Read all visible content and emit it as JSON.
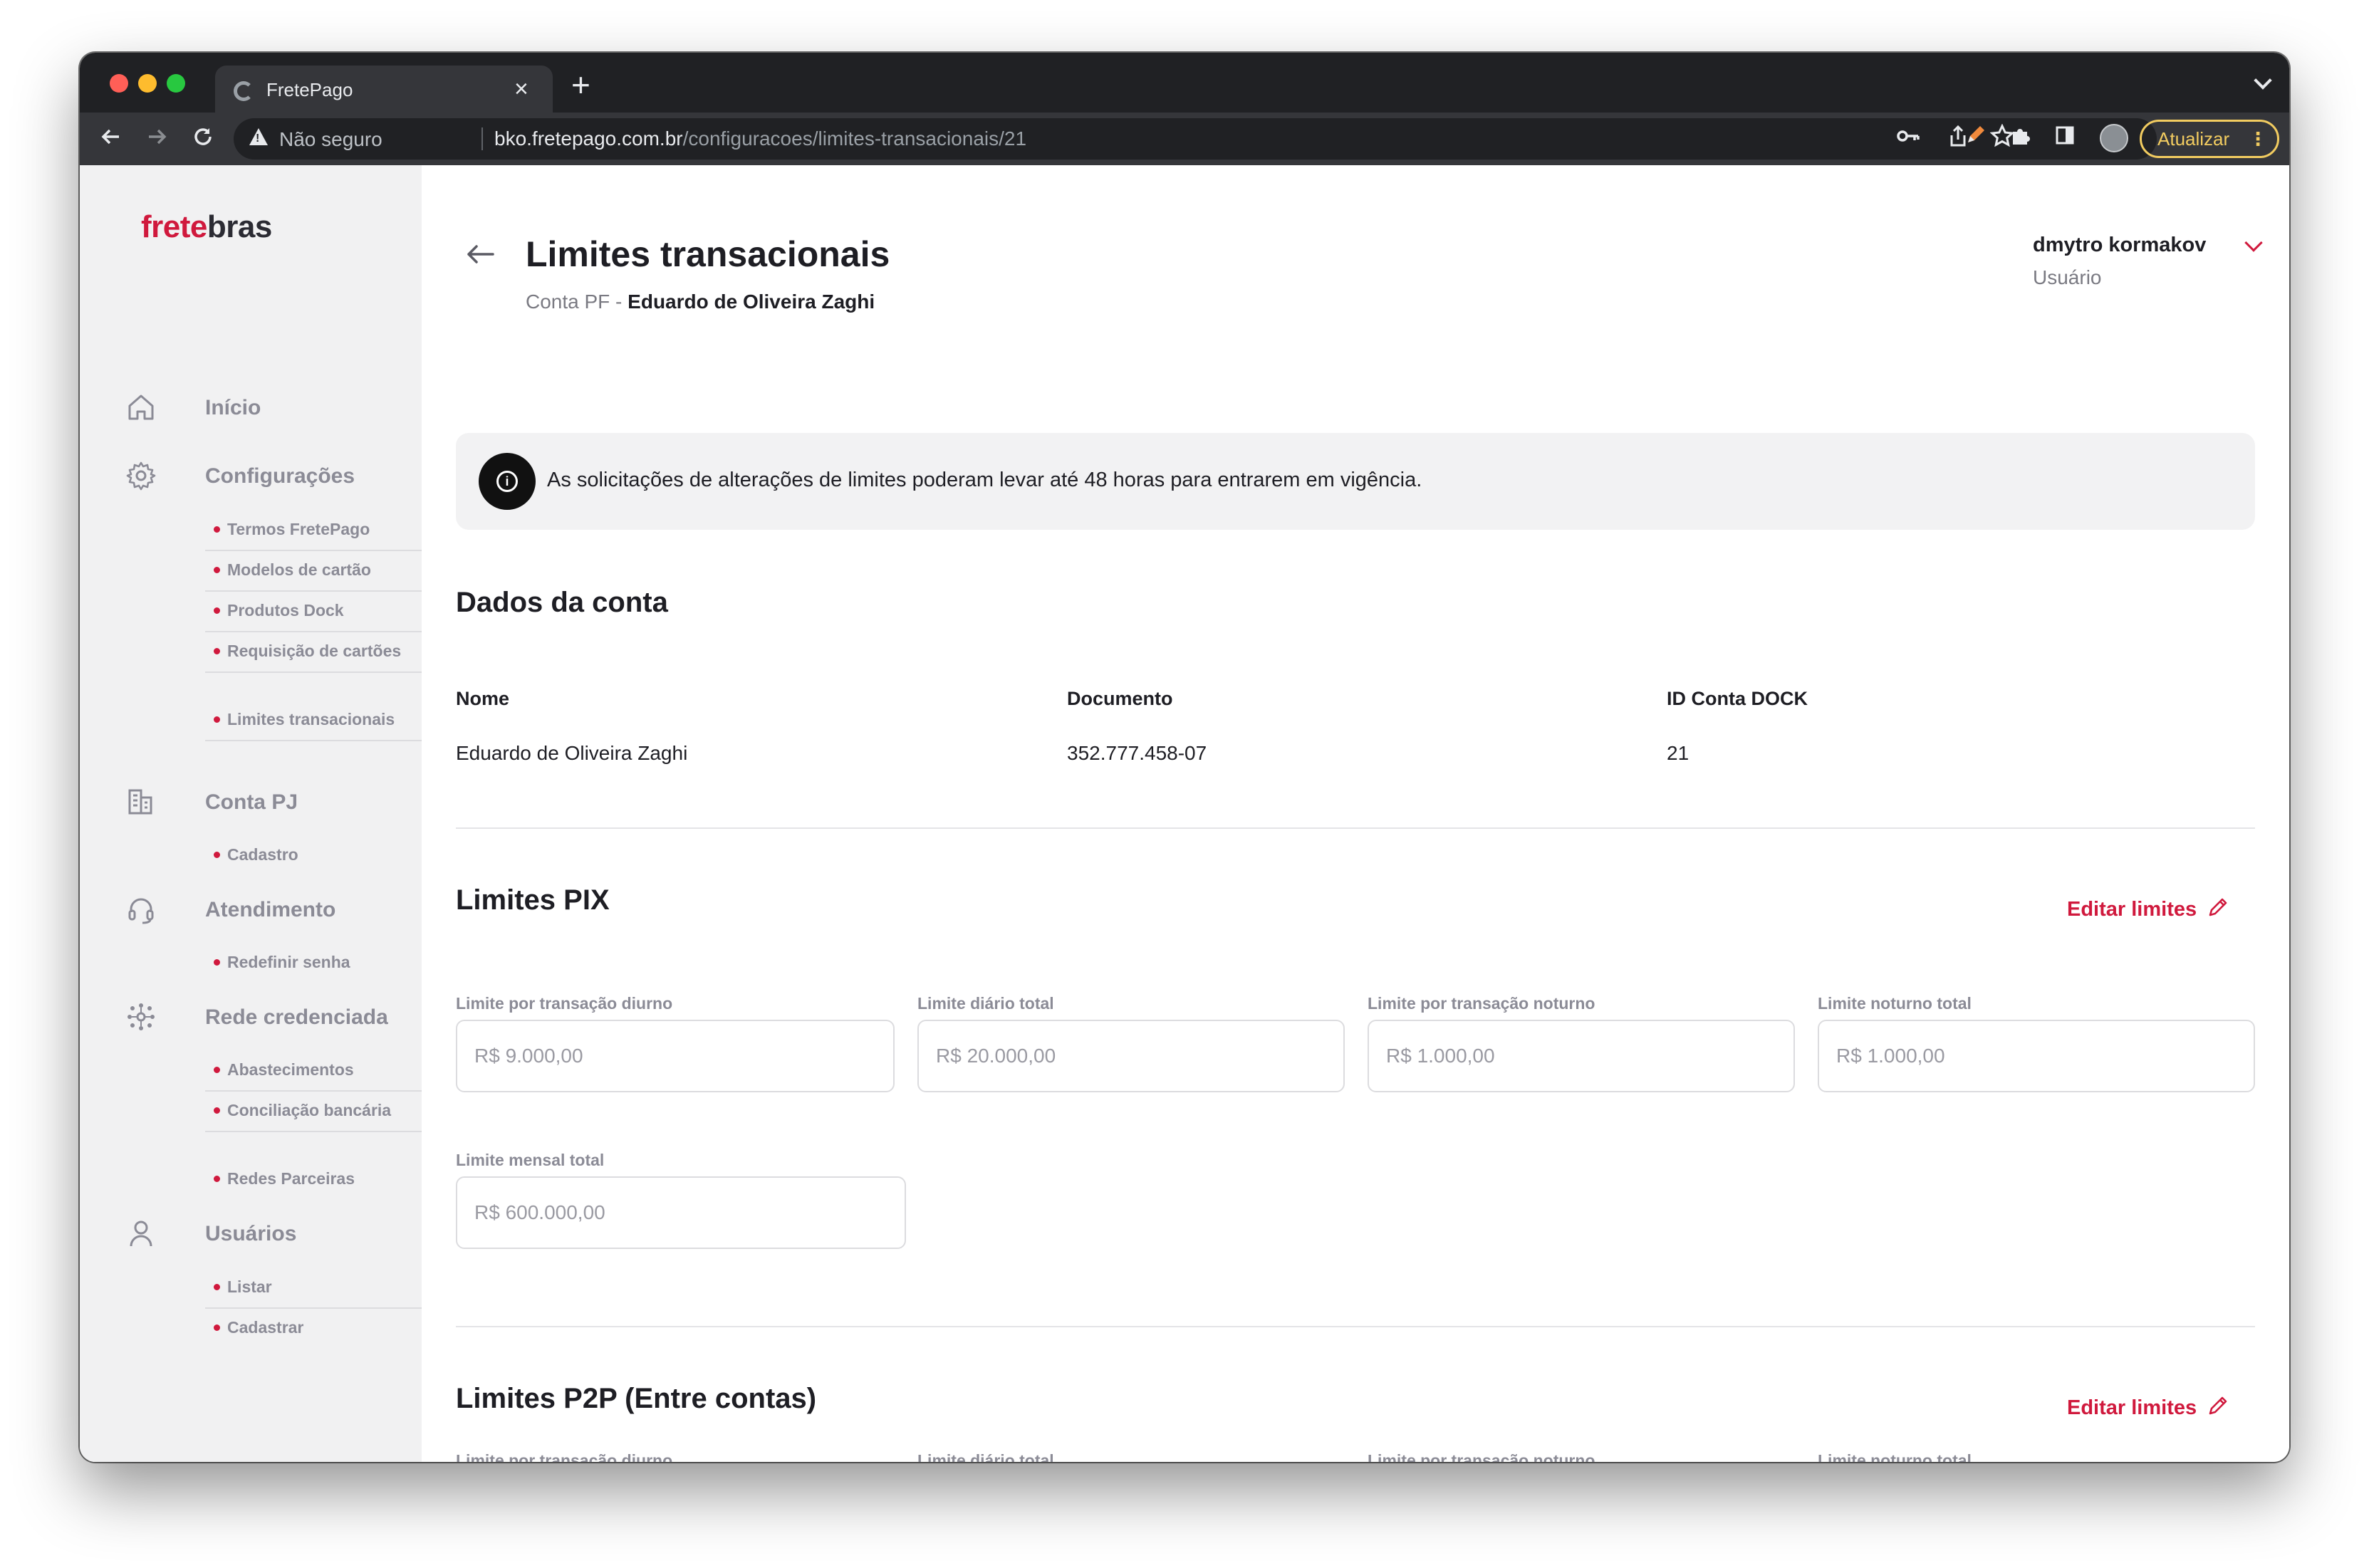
{
  "browser": {
    "tab_title": "FretePago",
    "security_label": "Não seguro",
    "url_host": "bko.fretepago.com.br",
    "url_path": "/configuracoes/limites-transacionais/21",
    "update_label": "Atualizar",
    "colors": {
      "chrome_dark": "#202124",
      "chrome_toolbar": "#35363a",
      "update_accent": "#f2cc60"
    }
  },
  "brand": {
    "logo_part1": "frete",
    "logo_part2": "bras",
    "accent_color": "#d0193d"
  },
  "sidebar": {
    "groups": [
      {
        "label": "Início",
        "icon": "home-icon",
        "items": []
      },
      {
        "label": "Configurações",
        "icon": "gear-icon",
        "items": [
          "Termos FretePago",
          "Modelos de cartão",
          "Produtos Dock",
          "Requisição de cartões",
          "Limites transacionais"
        ]
      },
      {
        "label": "Conta PJ",
        "icon": "building-icon",
        "items": [
          "Cadastro"
        ]
      },
      {
        "label": "Atendimento",
        "icon": "headset-icon",
        "items": [
          "Redefinir senha"
        ]
      },
      {
        "label": "Rede credenciada",
        "icon": "network-icon",
        "items": [
          "Abastecimentos",
          "Conciliação bancária",
          "Redes Parceiras"
        ]
      },
      {
        "label": "Usuários",
        "icon": "user-icon",
        "items": [
          "Listar",
          "Cadastrar"
        ]
      }
    ]
  },
  "header": {
    "title": "Limites transacionais",
    "subtitle_prefix": "Conta PF - ",
    "subtitle_name": "Eduardo de Oliveira Zaghi",
    "user_name": "dmytro kormakov",
    "user_role": "Usuário"
  },
  "alert": {
    "icon": "info-icon",
    "text": "As solicitações de alterações de limites poderam levar até 48 horas para entrarem em vigência."
  },
  "account": {
    "title": "Dados da conta",
    "columns": [
      {
        "label": "Nome",
        "value": "Eduardo de Oliveira Zaghi"
      },
      {
        "label": "Documento",
        "value": "352.777.458-07"
      },
      {
        "label": "ID Conta DOCK",
        "value": "21"
      }
    ]
  },
  "pix": {
    "title": "Limites PIX",
    "edit_label": "Editar limites",
    "fields": [
      {
        "label": "Limite por transação diurno",
        "value": "R$ 9.000,00"
      },
      {
        "label": "Limite diário total",
        "value": "R$ 20.000,00"
      },
      {
        "label": "Limite por transação noturno",
        "value": "R$ 1.000,00"
      },
      {
        "label": "Limite noturno total",
        "value": "R$ 1.000,00"
      },
      {
        "label": "Limite mensal total",
        "value": "R$ 600.000,00"
      }
    ]
  },
  "p2p": {
    "title": "Limites P2P (Entre contas)",
    "edit_label": "Editar limites",
    "fields": [
      {
        "label": "Limite por transação diurno"
      },
      {
        "label": "Limite diário total"
      },
      {
        "label": "Limite por transação noturno"
      },
      {
        "label": "Limite noturno total"
      }
    ]
  }
}
